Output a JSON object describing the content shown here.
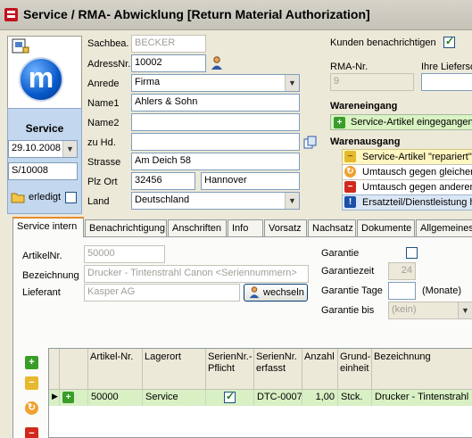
{
  "window": {
    "title": "Service / RMA- Abwicklung [Return Material Authorization]"
  },
  "left": {
    "service_label": "Service",
    "date_value": "29.10.2008",
    "number_value": "S/10008",
    "erledigt_label": "erledigt",
    "logo_letter": "m"
  },
  "address": {
    "sachbea_label": "Sachbea.",
    "sachbea_value": "BECKER",
    "adressnr_label": "AdressNr.",
    "adressnr_value": "10002",
    "anrede_label": "Anrede",
    "anrede_value": "Firma",
    "name1_label": "Name1",
    "name1_value": "Ahlers & Sohn",
    "name2_label": "Name2",
    "name2_value": "",
    "zuhd_label": "zu Hd.",
    "zuhd_value": "",
    "strasse_label": "Strasse",
    "strasse_value": "Am Deich 58",
    "plz_ort_label": "Plz  Ort",
    "plz_value": "32456",
    "ort_value": "Hannover",
    "land_label": "Land",
    "land_value": "Deutschland"
  },
  "right": {
    "kunden_label": "Kunden benachrichtigen",
    "kunden_checked": true,
    "rma_label": "RMA-Nr.",
    "rma_value": "9",
    "lieferschein_label": "Ihre Lieferschein",
    "wareneingang_title": "Wareneingang",
    "wareneingang_action": "Service-Artikel eingegangen",
    "warenausgang_title": "Warenausgang",
    "actions": [
      {
        "label": "Service-Artikel \"repariert\"",
        "style": "yellow",
        "icon": "minus-icon"
      },
      {
        "label": "Umtausch gegen gleichen",
        "style": "white",
        "icon": "exchange-icon"
      },
      {
        "label": "Umtausch gegen anderen",
        "style": "white",
        "icon": "remove-icon"
      },
      {
        "label": "Ersatzteil/Dienstleistung h",
        "style": "blue",
        "icon": "info-icon"
      }
    ]
  },
  "tabs": [
    {
      "label": "Service intern",
      "active": true
    },
    {
      "label": "Benachrichtigung"
    },
    {
      "label": "Anschriften"
    },
    {
      "label": "Info"
    },
    {
      "label": "Vorsatz"
    },
    {
      "label": "Nachsatz"
    },
    {
      "label": "Dokumente"
    },
    {
      "label": "Allgemeines"
    }
  ],
  "service_intern": {
    "artikelnr_label": "ArtikelNr.",
    "artikelnr_value": "50000",
    "bezeichnung_label": "Bezeichnung",
    "bezeichnung_value": "Drucker - Tintenstrahl Canon <Seriennummern>",
    "lieferant_label": "Lieferant",
    "lieferant_value": "Kasper AG",
    "wechseln_label": "wechseln",
    "garantie_label": "Garantie",
    "garantiezeit_label": "Garantiezeit",
    "garantiezeit_value": "24",
    "garantie_tage_label": "Garantie Tage",
    "garantie_tage_value": "",
    "monate_label": "(Monate)",
    "garantie_bis_label": "Garantie bis",
    "garantie_bis_value": "(kein)"
  },
  "grid": {
    "columns": [
      "Artikel-Nr.",
      "Lagerort",
      "SerienNr.-Pflicht",
      "SerienNr. erfasst",
      "Anzahl",
      "Grund-einheit",
      "Bezeichnung"
    ],
    "rows": [
      {
        "artikelnr": "50000",
        "lagerort": "Service",
        "pflicht": true,
        "erfasst": "DTC-0007",
        "anzahl": "1,00",
        "einheit": "Stck.",
        "bezeichnung": "Drucker - Tintenstrahl"
      }
    ]
  },
  "colors": {
    "accent_tab": "#e68b2c",
    "row_highlight": "#d8f0c4",
    "title_bar": "#c5c2b8"
  }
}
